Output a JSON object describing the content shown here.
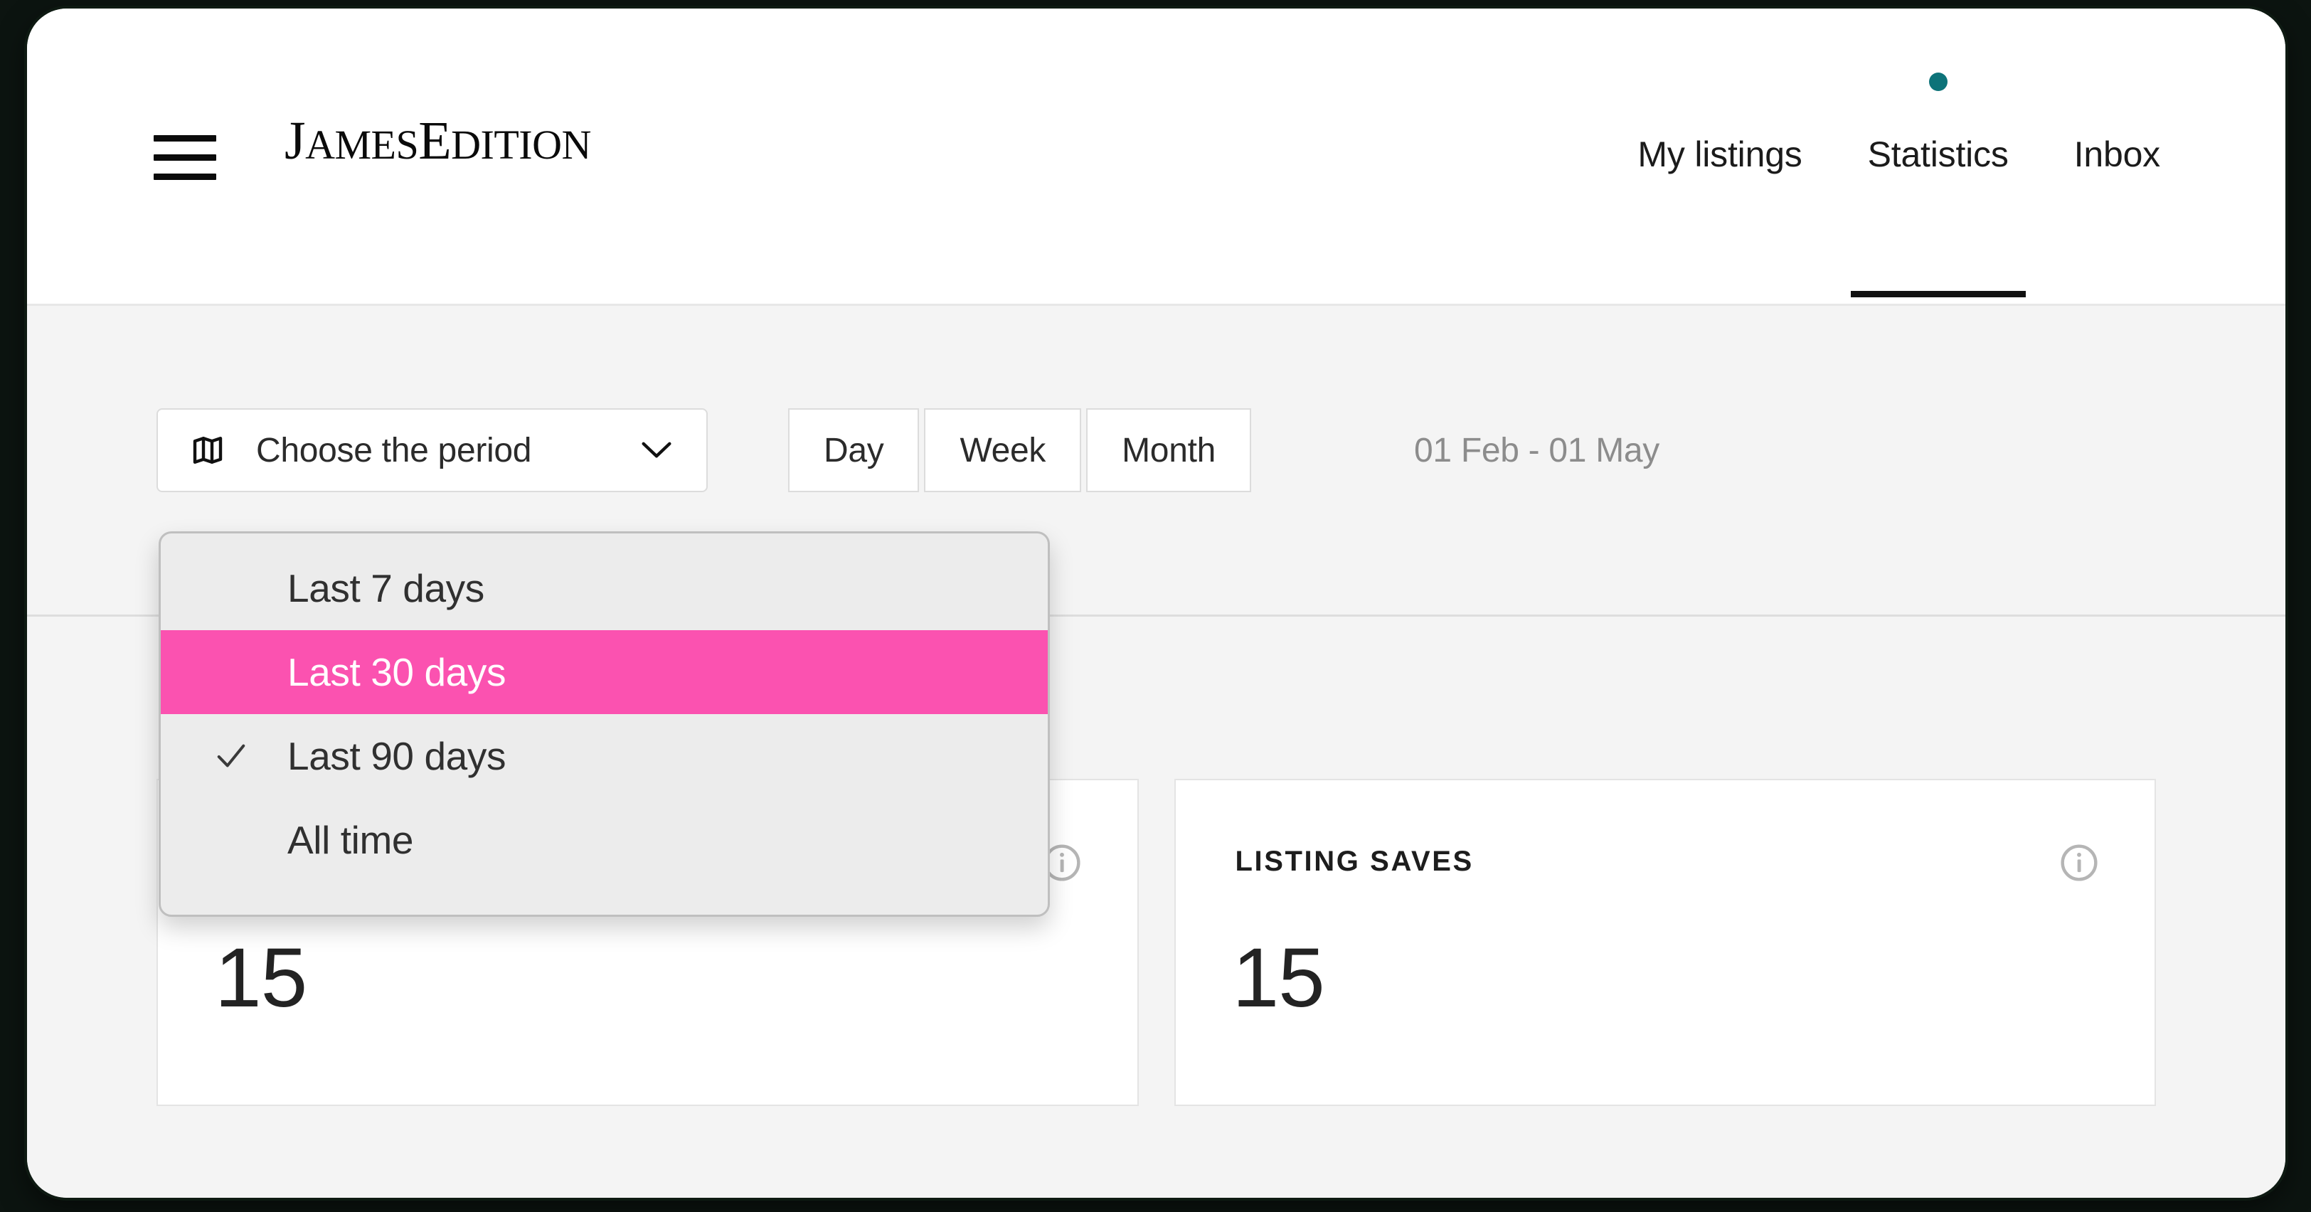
{
  "header": {
    "menu_icon": "hamburger-icon",
    "logo_text": "JamesEdition",
    "logo_part1": "J",
    "logo_part2": "AMES",
    "logo_part3": "E",
    "logo_part4": "DITION",
    "nav": [
      {
        "label": "My listings",
        "active": false,
        "has_dot": false
      },
      {
        "label": "Statistics",
        "active": true,
        "has_dot": true
      },
      {
        "label": "Inbox",
        "active": false,
        "has_dot": false
      }
    ],
    "active_tab_underline_color": "#111111",
    "notification_dot_color": "#0D7379"
  },
  "toolbar": {
    "period_select": {
      "icon": "map-icon",
      "label": "Choose the period",
      "chevron_icon": "chevron-down-icon"
    },
    "granularity": [
      {
        "label": "Day",
        "selected": false
      },
      {
        "label": "Week",
        "selected": false
      },
      {
        "label": "Month",
        "selected": false
      }
    ],
    "date_range": "01 Feb - 01 May"
  },
  "dropdown": {
    "open": true,
    "highlight_color": "#FB52B0",
    "background_color": "#ECECEC",
    "items": [
      {
        "label": "Last 7 days",
        "checked": false,
        "highlighted": false
      },
      {
        "label": "Last 30 days",
        "checked": false,
        "highlighted": true
      },
      {
        "label": "Last 90 days",
        "checked": true,
        "highlighted": false
      },
      {
        "label": "All time",
        "checked": false,
        "highlighted": false
      }
    ],
    "check_icon": "check-icon"
  },
  "cards": [
    {
      "title": "",
      "value": "15",
      "info_icon": "info-icon"
    },
    {
      "title": "LISTING SAVES",
      "value": "15",
      "info_icon": "info-icon"
    }
  ]
}
